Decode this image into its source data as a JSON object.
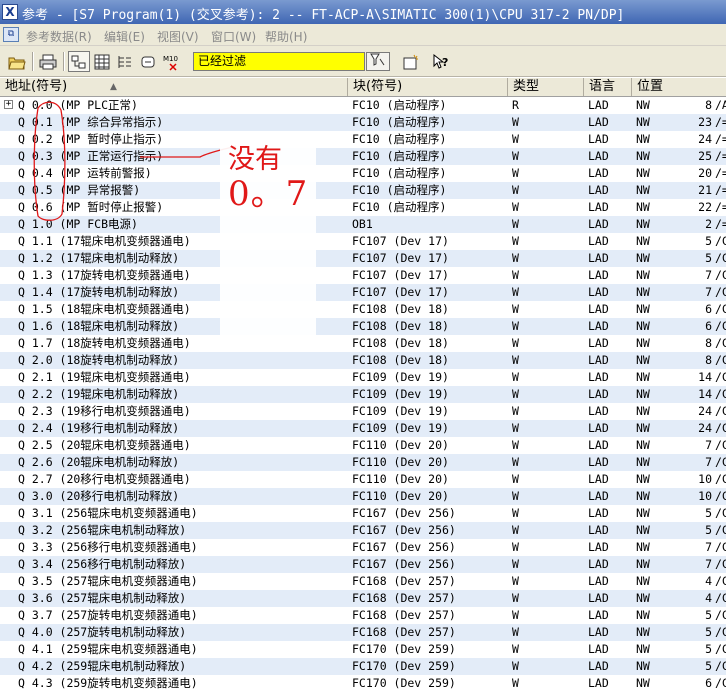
{
  "window": {
    "title": "参考 - [S7 Program(1) (交叉参考): 2 -- FT-ACP-A\\SIMATIC 300(1)\\CPU 317-2 PN/DP]"
  },
  "menu": [
    "参考数据(R)",
    "编辑(E)",
    "视图(V)",
    "窗口(W)",
    "帮助(H)"
  ],
  "toolbar": {
    "buttons": [
      "open-icon",
      "print-icon",
      "cross-reference-icon",
      "assignment-icon",
      "program-structure-icon",
      "unused-symbols-icon",
      "m10-filter-icon"
    ],
    "filter_value": "已经过滤",
    "filter_icon": "filter-settings-icon",
    "extra_buttons": [
      "new-window-icon",
      "help-cursor-icon"
    ]
  },
  "table": {
    "columns": [
      "地址(符号)",
      "块(符号)",
      "类型",
      "语言",
      "位置"
    ],
    "rows": [
      {
        "addr": "Q 0.0 (MP PLC正常)",
        "blk": "FC10 (启动程序)",
        "type": "R",
        "lang": "LAD",
        "nw": "NW",
        "num": "8",
        "tail": "/A"
      },
      {
        "addr": "Q 0.1 (MP 综合异常指示)",
        "blk": "FC10 (启动程序)",
        "type": "W",
        "lang": "LAD",
        "nw": "NW",
        "num": "23",
        "tail": "/="
      },
      {
        "addr": "Q 0.2 (MP 暂时停止指示)",
        "blk": "FC10 (启动程序)",
        "type": "W",
        "lang": "LAD",
        "nw": "NW",
        "num": "24",
        "tail": "/="
      },
      {
        "addr": "Q 0.3 (MP 正常运行指示)",
        "blk": "FC10 (启动程序)",
        "type": "W",
        "lang": "LAD",
        "nw": "NW",
        "num": "25",
        "tail": "/="
      },
      {
        "addr": "Q 0.4 (MP 运转前警报)",
        "blk": "FC10 (启动程序)",
        "type": "W",
        "lang": "LAD",
        "nw": "NW",
        "num": "20",
        "tail": "/="
      },
      {
        "addr": "Q 0.5 (MP 异常报警)",
        "blk": "FC10 (启动程序)",
        "type": "W",
        "lang": "LAD",
        "nw": "NW",
        "num": "21",
        "tail": "/="
      },
      {
        "addr": "Q 0.6 (MP 暂时停止报警)",
        "blk": "FC10 (启动程序)",
        "type": "W",
        "lang": "LAD",
        "nw": "NW",
        "num": "22",
        "tail": "/="
      },
      {
        "addr": "Q 1.0 (MP FCB电源)",
        "blk": "OB1",
        "type": "W",
        "lang": "LAD",
        "nw": "NW",
        "num": "2",
        "tail": "/="
      },
      {
        "addr": "Q 1.1 (17辊床电机变频器通电)",
        "blk": "FC107 (Dev 17)",
        "type": "W",
        "lang": "LAD",
        "nw": "NW",
        "num": "5",
        "tail": "/C"
      },
      {
        "addr": "Q 1.2 (17辊床电机制动释放)",
        "blk": "FC107 (Dev 17)",
        "type": "W",
        "lang": "LAD",
        "nw": "NW",
        "num": "5",
        "tail": "/C"
      },
      {
        "addr": "Q 1.3 (17旋转电机变频器通电)",
        "blk": "FC107 (Dev 17)",
        "type": "W",
        "lang": "LAD",
        "nw": "NW",
        "num": "7",
        "tail": "/C"
      },
      {
        "addr": "Q 1.4 (17旋转电机制动释放)",
        "blk": "FC107 (Dev 17)",
        "type": "W",
        "lang": "LAD",
        "nw": "NW",
        "num": "7",
        "tail": "/C"
      },
      {
        "addr": "Q 1.5 (18辊床电机变频器通电)",
        "blk": "FC108 (Dev 18)",
        "type": "W",
        "lang": "LAD",
        "nw": "NW",
        "num": "6",
        "tail": "/C"
      },
      {
        "addr": "Q 1.6 (18辊床电机制动释放)",
        "blk": "FC108 (Dev 18)",
        "type": "W",
        "lang": "LAD",
        "nw": "NW",
        "num": "6",
        "tail": "/C"
      },
      {
        "addr": "Q 1.7 (18旋转电机变频器通电)",
        "blk": "FC108 (Dev 18)",
        "type": "W",
        "lang": "LAD",
        "nw": "NW",
        "num": "8",
        "tail": "/C"
      },
      {
        "addr": "Q 2.0 (18旋转电机制动释放)",
        "blk": "FC108 (Dev 18)",
        "type": "W",
        "lang": "LAD",
        "nw": "NW",
        "num": "8",
        "tail": "/C"
      },
      {
        "addr": "Q 2.1 (19辊床电机变频器通电)",
        "blk": "FC109 (Dev 19)",
        "type": "W",
        "lang": "LAD",
        "nw": "NW",
        "num": "14",
        "tail": "/C"
      },
      {
        "addr": "Q 2.2 (19辊床电机制动释放)",
        "blk": "FC109 (Dev 19)",
        "type": "W",
        "lang": "LAD",
        "nw": "NW",
        "num": "14",
        "tail": "/C"
      },
      {
        "addr": "Q 2.3 (19移行电机变频器通电)",
        "blk": "FC109 (Dev 19)",
        "type": "W",
        "lang": "LAD",
        "nw": "NW",
        "num": "24",
        "tail": "/C"
      },
      {
        "addr": "Q 2.4 (19移行电机制动释放)",
        "blk": "FC109 (Dev 19)",
        "type": "W",
        "lang": "LAD",
        "nw": "NW",
        "num": "24",
        "tail": "/C"
      },
      {
        "addr": "Q 2.5 (20辊床电机变频器通电)",
        "blk": "FC110 (Dev 20)",
        "type": "W",
        "lang": "LAD",
        "nw": "NW",
        "num": "7",
        "tail": "/C"
      },
      {
        "addr": "Q 2.6 (20辊床电机制动释放)",
        "blk": "FC110 (Dev 20)",
        "type": "W",
        "lang": "LAD",
        "nw": "NW",
        "num": "7",
        "tail": "/C"
      },
      {
        "addr": "Q 2.7 (20移行电机变频器通电)",
        "blk": "FC110 (Dev 20)",
        "type": "W",
        "lang": "LAD",
        "nw": "NW",
        "num": "10",
        "tail": "/C"
      },
      {
        "addr": "Q 3.0 (20移行电机制动释放)",
        "blk": "FC110 (Dev 20)",
        "type": "W",
        "lang": "LAD",
        "nw": "NW",
        "num": "10",
        "tail": "/C"
      },
      {
        "addr": "Q 3.1 (256辊床电机变频器通电)",
        "blk": "FC167 (Dev 256)",
        "type": "W",
        "lang": "LAD",
        "nw": "NW",
        "num": "5",
        "tail": "/C"
      },
      {
        "addr": "Q 3.2 (256辊床电机制动释放)",
        "blk": "FC167 (Dev 256)",
        "type": "W",
        "lang": "LAD",
        "nw": "NW",
        "num": "5",
        "tail": "/C"
      },
      {
        "addr": "Q 3.3 (256移行电机变频器通电)",
        "blk": "FC167 (Dev 256)",
        "type": "W",
        "lang": "LAD",
        "nw": "NW",
        "num": "7",
        "tail": "/C"
      },
      {
        "addr": "Q 3.4 (256移行电机制动释放)",
        "blk": "FC167 (Dev 256)",
        "type": "W",
        "lang": "LAD",
        "nw": "NW",
        "num": "7",
        "tail": "/C"
      },
      {
        "addr": "Q 3.5 (257辊床电机变频器通电)",
        "blk": "FC168 (Dev 257)",
        "type": "W",
        "lang": "LAD",
        "nw": "NW",
        "num": "4",
        "tail": "/C"
      },
      {
        "addr": "Q 3.6 (257辊床电机制动释放)",
        "blk": "FC168 (Dev 257)",
        "type": "W",
        "lang": "LAD",
        "nw": "NW",
        "num": "4",
        "tail": "/C"
      },
      {
        "addr": "Q 3.7 (257旋转电机变频器通电)",
        "blk": "FC168 (Dev 257)",
        "type": "W",
        "lang": "LAD",
        "nw": "NW",
        "num": "5",
        "tail": "/C"
      },
      {
        "addr": "Q 4.0 (257旋转电机制动释放)",
        "blk": "FC168 (Dev 257)",
        "type": "W",
        "lang": "LAD",
        "nw": "NW",
        "num": "5",
        "tail": "/C"
      },
      {
        "addr": "Q 4.1 (259辊床电机变频器通电)",
        "blk": "FC170 (Dev 259)",
        "type": "W",
        "lang": "LAD",
        "nw": "NW",
        "num": "5",
        "tail": "/C"
      },
      {
        "addr": "Q 4.2 (259辊床电机制动释放)",
        "blk": "FC170 (Dev 259)",
        "type": "W",
        "lang": "LAD",
        "nw": "NW",
        "num": "5",
        "tail": "/C"
      },
      {
        "addr": "Q 4.3 (259旋转电机变频器通电)",
        "blk": "FC170 (Dev 259)",
        "type": "W",
        "lang": "LAD",
        "nw": "NW",
        "num": "6",
        "tail": "/C"
      }
    ]
  },
  "annotation": {
    "line1": "没有",
    "line2": "0。7",
    "color": "#e01818"
  }
}
